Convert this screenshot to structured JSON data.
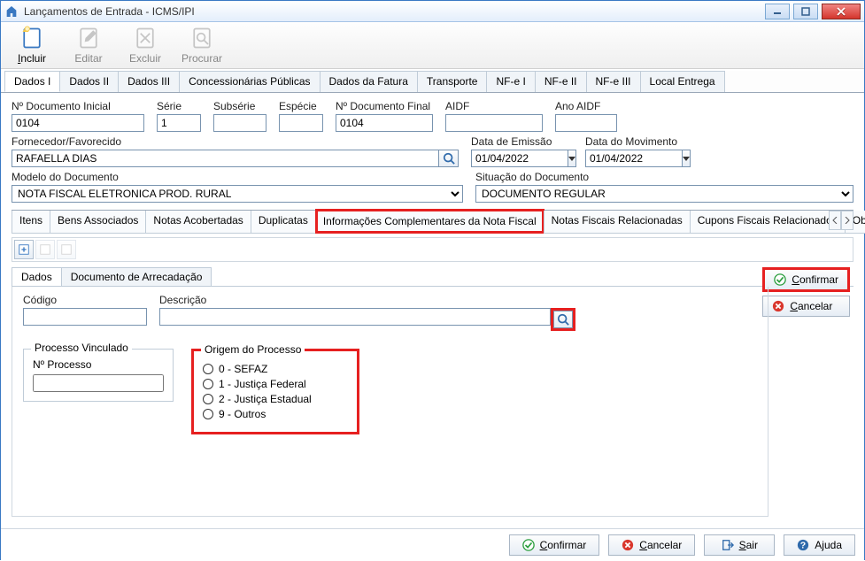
{
  "window": {
    "title": "Lançamentos de Entrada - ICMS/IPI"
  },
  "toolbar": {
    "incluir": "Incluir",
    "editar": "Editar",
    "excluir": "Excluir",
    "procurar": "Procurar"
  },
  "main_tabs": [
    {
      "label": "Dados I",
      "active": true
    },
    {
      "label": "Dados II"
    },
    {
      "label": "Dados III"
    },
    {
      "label": "Concessionárias Públicas"
    },
    {
      "label": "Dados da Fatura"
    },
    {
      "label": "Transporte"
    },
    {
      "label": "NF-e I"
    },
    {
      "label": "NF-e II"
    },
    {
      "label": "NF-e III"
    },
    {
      "label": "Local Entrega"
    }
  ],
  "fields": {
    "num_doc_inicial": {
      "label": "Nº Documento Inicial",
      "value": "0104"
    },
    "serie": {
      "label": "Série",
      "value": "1"
    },
    "subserie": {
      "label": "Subsérie",
      "value": ""
    },
    "especie": {
      "label": "Espécie",
      "value": ""
    },
    "num_doc_final": {
      "label": "Nº Documento Final",
      "value": "0104"
    },
    "aidf": {
      "label": "AIDF",
      "value": ""
    },
    "ano_aidf": {
      "label": "Ano AIDF",
      "value": ""
    },
    "fornecedor": {
      "label": "Fornecedor/Favorecido",
      "value": "RAFAELLA DIAS"
    },
    "data_emissao": {
      "label": "Data de Emissão",
      "value": "01/04/2022"
    },
    "data_movimento": {
      "label": "Data do Movimento",
      "value": "01/04/2022"
    },
    "modelo": {
      "label": "Modelo do Documento",
      "value": "NOTA FISCAL ELETRONICA PROD. RURAL"
    },
    "situacao": {
      "label": "Situação do Documento",
      "value": "DOCUMENTO REGULAR"
    }
  },
  "sub_tabs": [
    {
      "label": "Itens"
    },
    {
      "label": "Bens Associados"
    },
    {
      "label": "Notas Acobertadas"
    },
    {
      "label": "Duplicatas"
    },
    {
      "label": "Informações Complementares da Nota Fiscal",
      "highlighted": true
    },
    {
      "label": "Notas Fiscais Relacionadas"
    },
    {
      "label": "Cupons Fiscais Relacionados"
    },
    {
      "label": "Observaçõ"
    }
  ],
  "inner_tabs": [
    {
      "label": "Dados",
      "active": true
    },
    {
      "label": "Documento de Arrecadação"
    }
  ],
  "inner_fields": {
    "codigo": {
      "label": "Código",
      "value": ""
    },
    "descricao": {
      "label": "Descrição",
      "value": ""
    }
  },
  "processo_vinculado": {
    "title": "Processo Vinculado",
    "num_processo_label": "Nº Processo",
    "num_processo_value": ""
  },
  "origem_processo": {
    "title": "Origem do Processo",
    "options": [
      "0 - SEFAZ",
      "1 - Justiça Federal",
      "2 - Justiça Estadual",
      "9 - Outros"
    ]
  },
  "side_actions": {
    "confirmar": "Confirmar",
    "cancelar": "Cancelar"
  },
  "bottom_actions": {
    "confirmar": "Confirmar",
    "cancelar": "Cancelar",
    "sair": "Sair",
    "ajuda": "Ajuda"
  }
}
